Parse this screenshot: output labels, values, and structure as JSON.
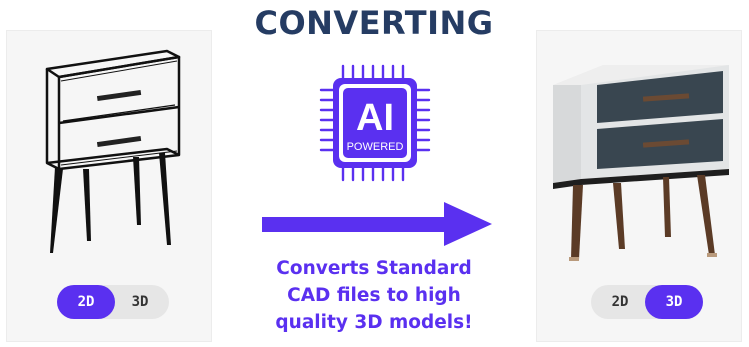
{
  "header": {
    "title": "CONVERTING"
  },
  "badge": {
    "main_text": "AI",
    "sub_text": "POWERED"
  },
  "caption": {
    "text": "Converts  Standard\nCAD files to high\nquality 3D models!"
  },
  "left_panel": {
    "toggle": {
      "option_2d": "2D",
      "option_3d": "3D",
      "selected": "2D"
    }
  },
  "right_panel": {
    "toggle": {
      "option_2d": "2D",
      "option_3d": "3D",
      "selected": "3D"
    }
  },
  "colors": {
    "accent": "#5a30f0",
    "title": "#253c63",
    "drawer_front": "#394650",
    "cabinet": "#d9dcdd",
    "leg_wood": "#5b3b26"
  }
}
